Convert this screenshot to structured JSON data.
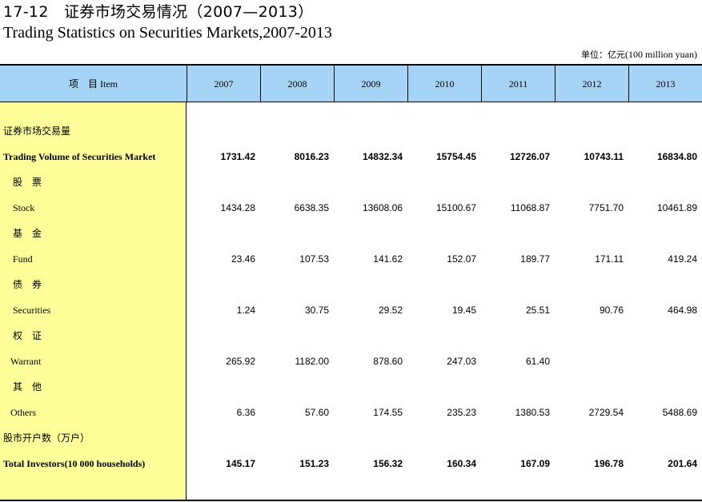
{
  "title_cn": "17-12　证券市场交易情况（2007—2013）",
  "title_en": "Trading Statistics on Securities Markets,2007-2013",
  "unit": {
    "cn": "单位：亿元",
    "en": "(100 million yuan)"
  },
  "header": {
    "item_cn": "项　目",
    "item_en": "Item",
    "years": [
      "2007",
      "2008",
      "2009",
      "2010",
      "2011",
      "2012",
      "2013"
    ]
  },
  "rows": [
    {
      "label": "证券市场交易量",
      "cn": true,
      "indent": 4,
      "bold": false,
      "values": []
    },
    {
      "label": "Trading Volume of Securities Market",
      "cn": false,
      "indent": 4,
      "bold": true,
      "values": [
        "1731.42",
        "8016.23",
        "14832.34",
        "15754.45",
        "12726.07",
        "10743.11",
        "16834.80"
      ]
    },
    {
      "label": "股　票",
      "cn": true,
      "indent": 16,
      "bold": false,
      "values": []
    },
    {
      "label": "Stock",
      "cn": false,
      "indent": 16,
      "bold": false,
      "values": [
        "1434.28",
        "6638.35",
        "13608.06",
        "15100.67",
        "11068.87",
        "7751.70",
        "10461.89"
      ]
    },
    {
      "label": "基　金",
      "cn": true,
      "indent": 16,
      "bold": false,
      "values": []
    },
    {
      "label": "Fund",
      "cn": false,
      "indent": 16,
      "bold": false,
      "values": [
        "23.46",
        "107.53",
        "141.62",
        "152.07",
        "189.77",
        "171.11",
        "419.24"
      ]
    },
    {
      "label": "债　券",
      "cn": true,
      "indent": 16,
      "bold": false,
      "values": []
    },
    {
      "label": "Securities",
      "cn": false,
      "indent": 16,
      "bold": false,
      "values": [
        "1.24",
        "30.75",
        "29.52",
        "19.45",
        "25.51",
        "90.76",
        "464.98"
      ]
    },
    {
      "label": "权　证",
      "cn": true,
      "indent": 16,
      "bold": false,
      "values": []
    },
    {
      "label": "Warrant",
      "cn": false,
      "indent": 13,
      "bold": false,
      "values": [
        "265.92",
        "1182.00",
        "878.60",
        "247.03",
        "61.40",
        "",
        ""
      ]
    },
    {
      "label": "其　他",
      "cn": true,
      "indent": 16,
      "bold": false,
      "values": []
    },
    {
      "label": "Others",
      "cn": false,
      "indent": 13,
      "bold": false,
      "values": [
        "6.36",
        "57.60",
        "174.55",
        "235.23",
        "1380.53",
        "2729.54",
        "5488.69"
      ]
    },
    {
      "label": "股市开户数（万户）",
      "cn": true,
      "indent": 4,
      "bold": false,
      "values": []
    },
    {
      "label": "Total Investors(10 000 households)",
      "cn": false,
      "indent": 4,
      "bold": true,
      "values": [
        "145.17",
        "151.23",
        "156.32",
        "160.34",
        "167.09",
        "196.78",
        "201.64"
      ]
    }
  ]
}
